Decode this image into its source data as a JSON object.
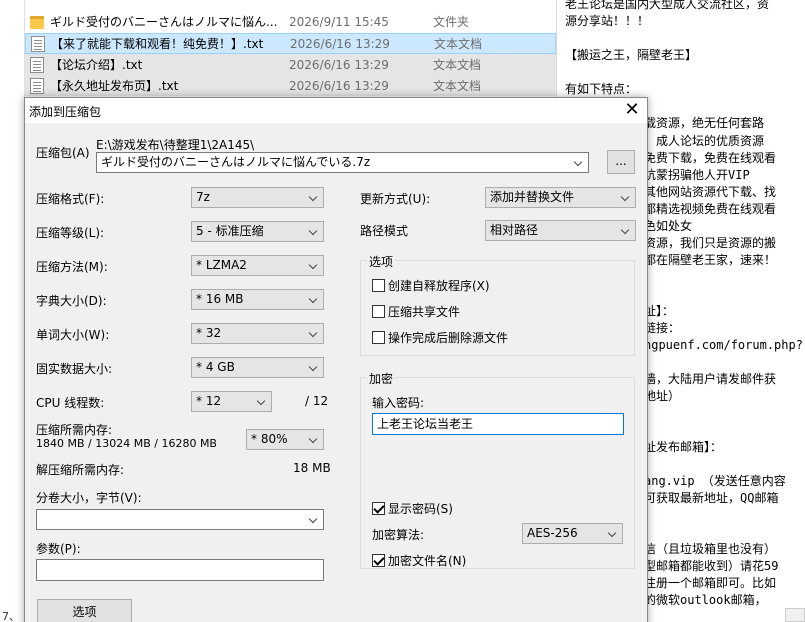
{
  "explorer": {
    "nav_text": "7、",
    "files": [
      {
        "name": "ギルド受付のバニーさんはノルマに悩ん...",
        "date": "2026/9/11 15:45",
        "type": "文件夹"
      },
      {
        "name": "【来了就能下载和观看！纯免费！】.txt",
        "date": "2026/6/16 13:29",
        "type": "文本文档"
      },
      {
        "name": "【论坛介绍】.txt",
        "date": "2026/6/16 13:29",
        "type": "文本文档"
      },
      {
        "name": "【永久地址发布页】.txt",
        "date": "2026/6/16 13:29",
        "type": "文本文档"
      }
    ]
  },
  "notepad": {
    "lines": [
      "老王论坛是国内大型成人交流社区，资",
      "源分享站！！！",
      "【搬运之王，隔壁老王】",
      "有如下特点：",
      "载资源，绝无任何套路",
      "、成人论坛的优质资源",
      "免费下载，免费在线观看",
      "坑蒙拐骗他人开VIP",
      "其他网站资源代下载、找",
      "都精选视频免费在线观看",
      "色如处女",
      "资源，我们只是资源的搬",
      "都在隔壁老王家，速来！",
      "址】：",
      "链接：",
      "ngpuenf.com/forum.php?",
      "墙，大陆用户请发邮件获",
      "地址）",
      "址发布邮箱】：",
      "ang.vip  （发送任意内容",
      "可获取最新地址，QQ邮箱",
      "信（且垃圾箱里也没有）",
      "型邮箱都能收到）请花59",
      "注册一个邮箱即可。比如",
      "的微软outlook邮箱，"
    ]
  },
  "dialog": {
    "title": "添加到压缩包",
    "close_glyph": "✕",
    "archive": {
      "label": "压缩包(A)",
      "folder": "E:\\游戏发布\\待整理1\\2A145\\",
      "filename": "ギルド受付のバニーさんはノルマに悩んでいる.7z",
      "browse": "..."
    },
    "left": {
      "format_label": "压缩格式(F):",
      "format_value": "7z",
      "level_label": "压缩等级(L):",
      "level_value": "5 - 标准压缩",
      "method_label": "压缩方法(M):",
      "method_value": "* LZMA2",
      "dict_label": "字典大小(D):",
      "dict_value": "* 16 MB",
      "word_label": "单词大小(W):",
      "word_value": "* 32",
      "solid_label": "固实数据大小:",
      "solid_value": "* 4 GB",
      "cpu_label": "CPU 线程数:",
      "cpu_value": "* 12",
      "cpu_max": "/ 12",
      "mem_compress_label": "压缩所需内存:",
      "mem_compress_value": "1840 MB / 13024 MB / 16280 MB",
      "mem_usage_value": "* 80%",
      "mem_decompress_label": "解压缩所需内存:",
      "mem_decompress_value": "18 MB",
      "split_label": "分卷大小，字节(V):",
      "split_value": "",
      "params_label": "参数(P):",
      "params_value": "",
      "options_button": "选项"
    },
    "right": {
      "update_label": "更新方式(U):",
      "update_value": "添加并替换文件",
      "path_label": "路径模式",
      "path_value": "相对路径",
      "options_title": "选项",
      "opt_sfx": "创建自释放程序(X)",
      "opt_shared": "压缩共享文件",
      "opt_delete": "操作完成后删除源文件",
      "encrypt_title": "加密",
      "password_label": "输入密码:",
      "password_value": "上老王论坛当老王",
      "show_password": "显示密码(S)",
      "method_label": "加密算法:",
      "method_value": "AES-256",
      "encrypt_names": "加密文件名(N)"
    }
  }
}
